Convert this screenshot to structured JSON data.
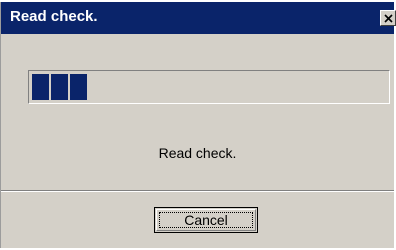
{
  "dialog": {
    "title": "Read check.",
    "close_icon": "close-icon",
    "status_text": "Read check.",
    "cancel_label": "Cancel"
  },
  "progress": {
    "filled_blocks": 3,
    "fill_fraction": 0.18,
    "block_color": "#0a246a"
  },
  "colors": {
    "titlebar": "#0a246a",
    "face": "#d4d0c8"
  }
}
